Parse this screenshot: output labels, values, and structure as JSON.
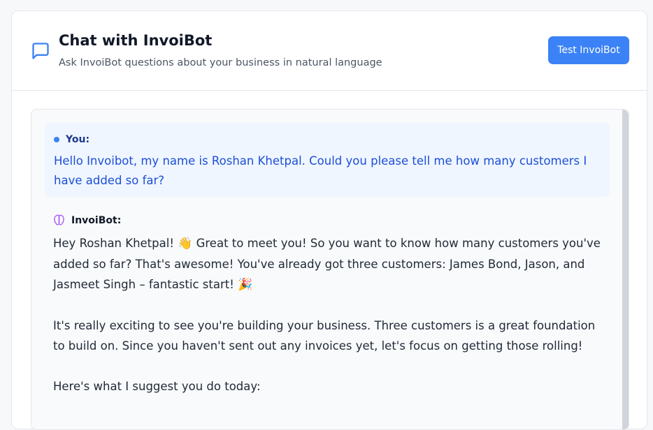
{
  "header": {
    "title": "Chat with InvoiBot",
    "subtitle": "Ask InvoiBot questions about your business in natural language",
    "test_button_label": "Test InvoiBot"
  },
  "messages": {
    "user": {
      "label": "You:",
      "text": "Hello Invoibot, my name is Roshan Khetpal. Could you please tell me how many customers I have added so far?"
    },
    "bot": {
      "label": "InvoiBot:",
      "p1_a": "Hey Roshan Khetpal! ",
      "p1_emoji": "👋",
      "p1_b": "  Great to meet you! So you want to know how many customers you've added so far?  That's awesome! You've already got three customers: James Bond, Jason, and Jasmeet Singh – fantastic start! ",
      "p1_emoji2": "🎉",
      "p2": "It's really exciting to see you're building your business.  Three customers is a great foundation to build on.  Since you haven't sent out any invoices yet, let's focus on getting those rolling!",
      "p3": "Here's what I suggest you do today:"
    }
  },
  "colors": {
    "accent": "#3b82f6",
    "user_bubble": "#eff6ff",
    "user_text": "#1d4ed8",
    "bot_icon": "#a855f7"
  },
  "icons": {
    "header": "message-square-icon",
    "user": "blue-dot-icon",
    "bot": "brain-icon"
  }
}
